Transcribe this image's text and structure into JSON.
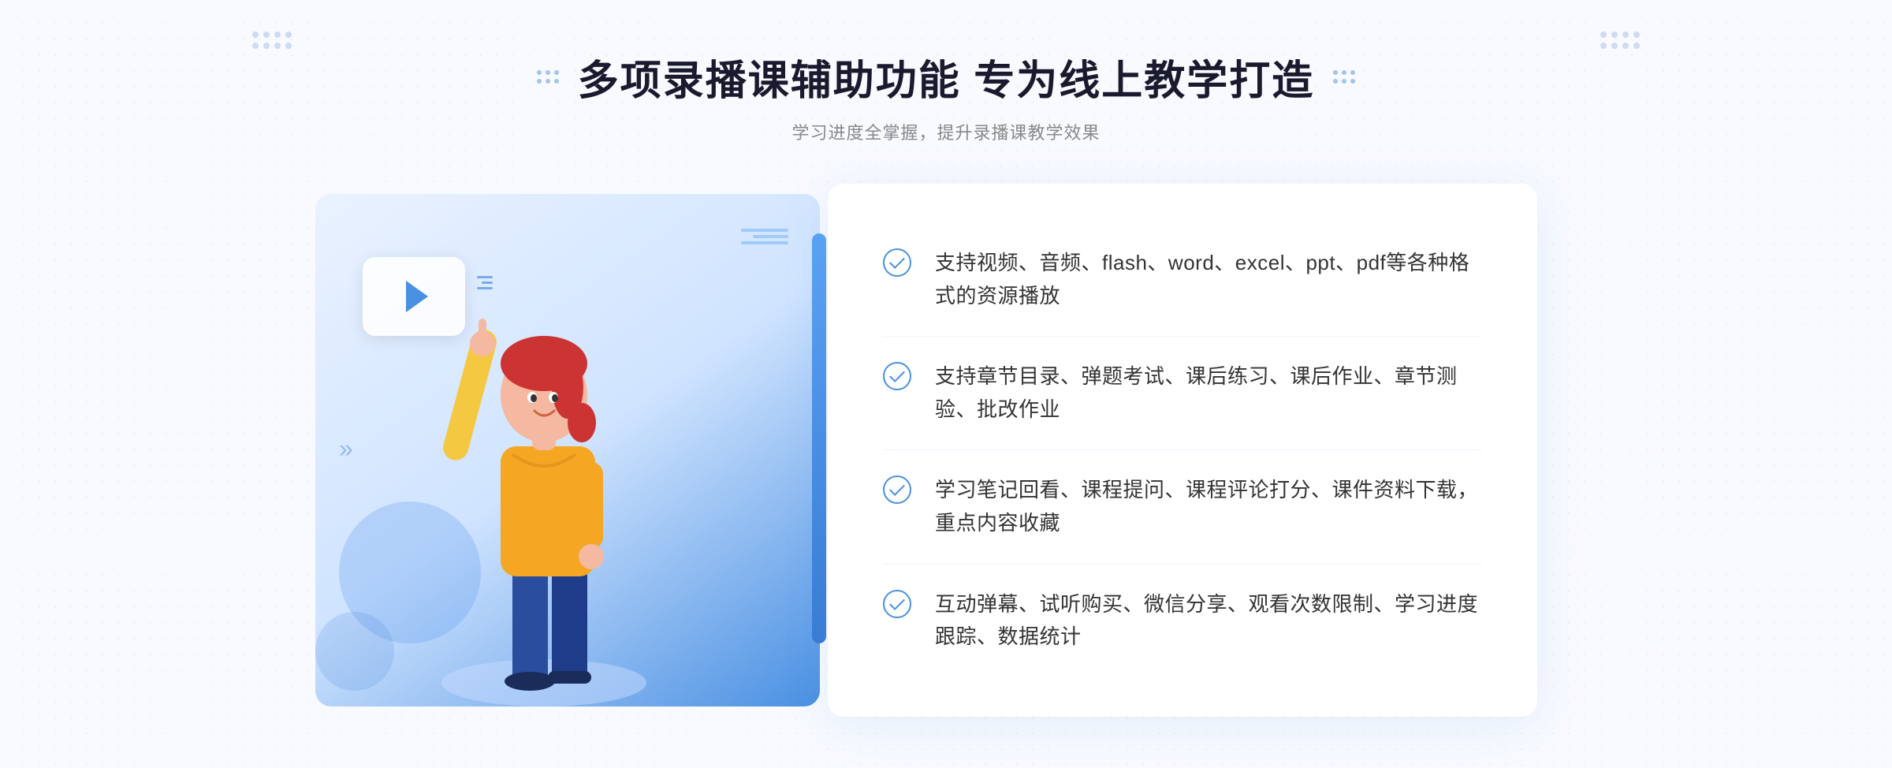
{
  "header": {
    "title": "多项录播课辅助功能 专为线上教学打造",
    "subtitle": "学习进度全掌握，提升录播课教学效果"
  },
  "features": [
    {
      "id": "feature-1",
      "text": "支持视频、音频、flash、word、excel、ppt、pdf等各种格式的资源播放"
    },
    {
      "id": "feature-2",
      "text": "支持章节目录、弹题考试、课后练习、课后作业、章节测验、批改作业"
    },
    {
      "id": "feature-3",
      "text": "学习笔记回看、课程提问、课程评论打分、课件资料下载，重点内容收藏"
    },
    {
      "id": "feature-4",
      "text": "互动弹幕、试听购买、微信分享、观看次数限制、学习进度跟踪、数据统计"
    }
  ],
  "decorations": {
    "left_chevron": "»",
    "play_button_aria": "play-icon"
  }
}
